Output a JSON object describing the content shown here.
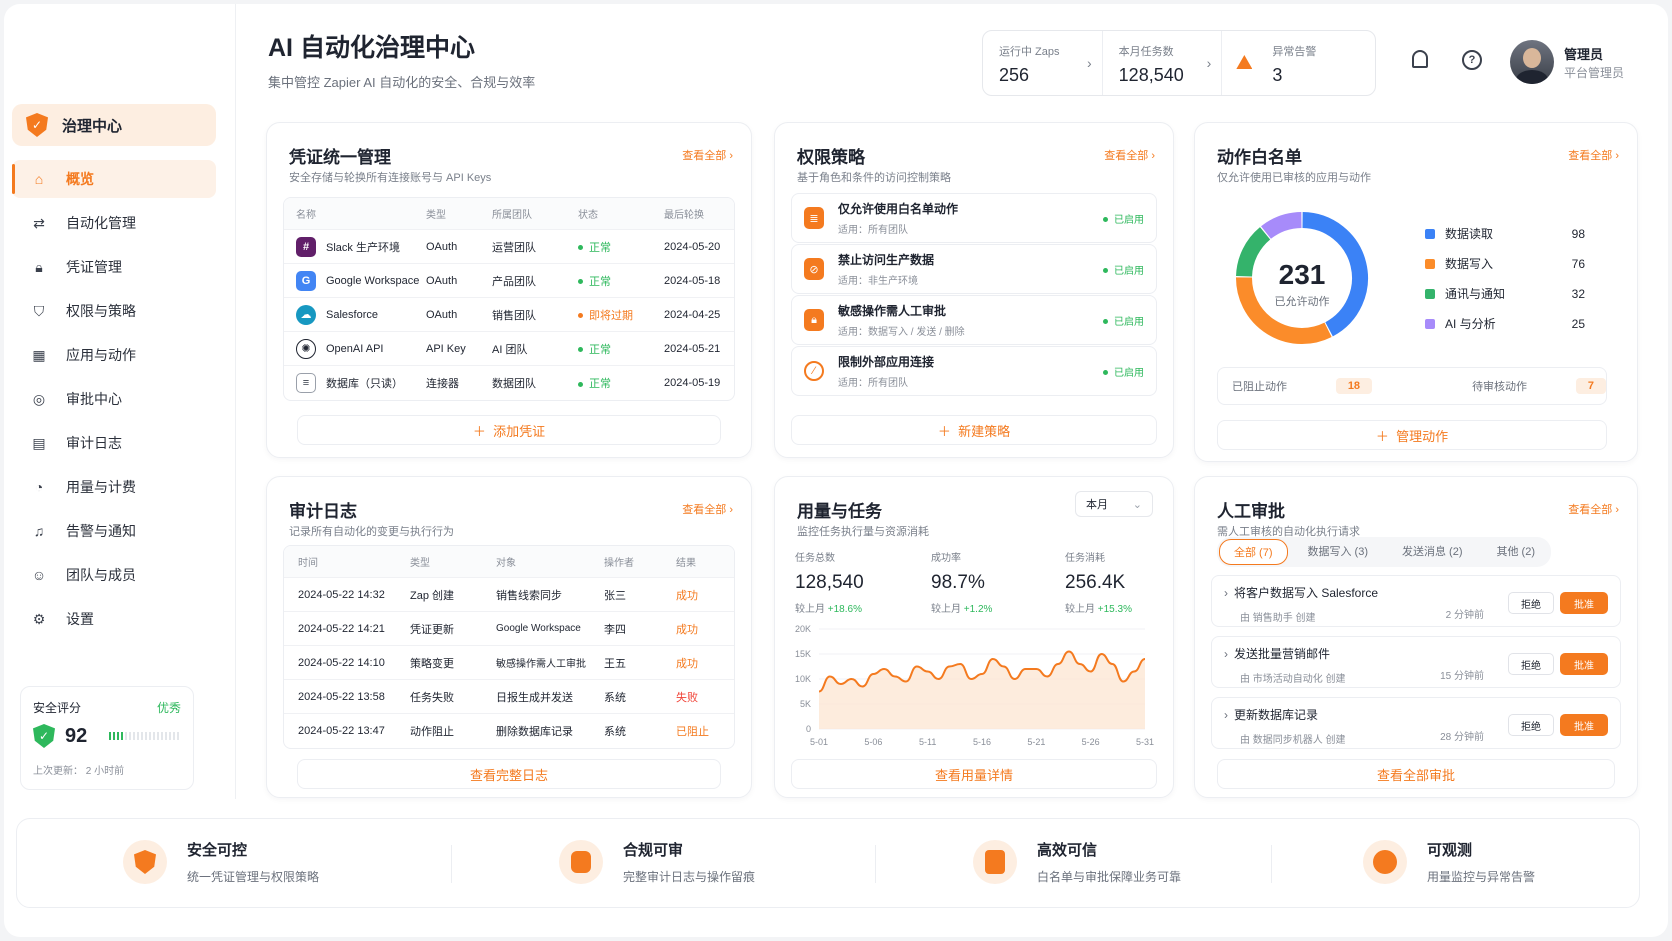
{
  "header": {
    "title": "AI 自动化治理中心",
    "subtitle": "集中管控 Zapier AI 自动化的安全、合规与效率"
  },
  "stats": [
    {
      "label": "运行中 Zaps",
      "value": "256"
    },
    {
      "label": "本月任务数",
      "value": "128,540"
    },
    {
      "label": "异常告警",
      "value": "3"
    }
  ],
  "user": {
    "name": "管理员",
    "role": "平台管理员"
  },
  "sidebar": {
    "brand": "治理中心",
    "items": [
      {
        "label": "概览",
        "icon": "home-icon"
      },
      {
        "label": "自动化管理",
        "icon": "flow-icon"
      },
      {
        "label": "凭证管理",
        "icon": "lock-icon"
      },
      {
        "label": "权限与策略",
        "icon": "shield-icon"
      },
      {
        "label": "应用与动作",
        "icon": "grid-icon"
      },
      {
        "label": "审批中心",
        "icon": "check-circle-icon"
      },
      {
        "label": "审计日志",
        "icon": "document-search-icon"
      },
      {
        "label": "用量与计费",
        "icon": "pie-icon"
      },
      {
        "label": "告警与通知",
        "icon": "bell-icon"
      },
      {
        "label": "团队与成员",
        "icon": "user-icon"
      },
      {
        "label": "设置",
        "icon": "gear-icon"
      }
    ],
    "score": {
      "label": "安全评分",
      "grade": "优秀",
      "value": "92",
      "updated": "上次更新： 2 小时前"
    }
  },
  "credentials": {
    "title": "凭证统一管理",
    "desc": "安全存储与轮换所有连接账号与 API Keys",
    "more": "查看全部",
    "columns": [
      "名称",
      "类型",
      "所属团队",
      "状态",
      "最后轮换"
    ],
    "rows": [
      [
        "Slack 生产环境",
        "OAuth",
        "运营团队",
        "正常",
        "2024-05-20"
      ],
      [
        "Google Workspace",
        "OAuth",
        "产品团队",
        "正常",
        "2024-05-18"
      ],
      [
        "Salesforce",
        "OAuth",
        "销售团队",
        "即将过期",
        "2024-04-25"
      ],
      [
        "OpenAI API",
        "API Key",
        "AI 团队",
        "正常",
        "2024-05-21"
      ],
      [
        "数据库（只读）",
        "连接器",
        "数据团队",
        "正常",
        "2024-05-19"
      ]
    ],
    "add": "添加凭证"
  },
  "policies": {
    "title": "权限策略",
    "desc": "基于角色和条件的访问控制策略",
    "more": "查看全部",
    "items": [
      {
        "title": "仅允许使用白名单动作",
        "scope": "适用：所有团队",
        "status": "已启用"
      },
      {
        "title": "禁止访问生产数据",
        "scope": "适用：非生产环境",
        "status": "已启用"
      },
      {
        "title": "敏感操作需人工审批",
        "scope": "适用：数据写入 / 发送 / 删除",
        "status": "已启用"
      },
      {
        "title": "限制外部应用连接",
        "scope": "适用：所有团队",
        "status": "已启用"
      }
    ],
    "add": "新建策略"
  },
  "whitelist": {
    "title": "动作白名单",
    "desc": "仅允许使用已审核的应用与动作",
    "more": "查看全部",
    "total": "231",
    "total_label": "已允许动作",
    "legend": [
      {
        "label": "数据读取",
        "value": 98,
        "color": "#3b82f6"
      },
      {
        "label": "数据写入",
        "value": 76,
        "color": "#fb8c2a"
      },
      {
        "label": "通讯与通知",
        "value": 32,
        "color": "#34b36b"
      },
      {
        "label": "AI 与分析",
        "value": 25,
        "color": "#a78bfa"
      }
    ],
    "blocked_label": "已阻止动作",
    "blocked": "18",
    "pending_label": "待审核动作",
    "pending": "7",
    "manage": "管理动作"
  },
  "audit": {
    "title": "审计日志",
    "desc": "记录所有自动化的变更与执行行为",
    "more": "查看全部",
    "columns": [
      "时间",
      "类型",
      "对象",
      "操作者",
      "结果"
    ],
    "rows": [
      [
        "2024-05-22 14:32",
        "Zap 创建",
        "销售线索同步",
        "张三",
        "成功"
      ],
      [
        "2024-05-22 14:21",
        "凭证更新",
        "Google Workspace",
        "李四",
        "成功"
      ],
      [
        "2024-05-22 14:10",
        "策略变更",
        "敏感操作需人工审批",
        "王五",
        "成功"
      ],
      [
        "2024-05-22 13:58",
        "任务失败",
        "日报生成并发送",
        "系统",
        "失败"
      ],
      [
        "2024-05-22 13:47",
        "动作阻止",
        "删除数据库记录",
        "系统",
        "已阻止"
      ]
    ],
    "full": "查看完整日志"
  },
  "usage": {
    "title": "用量与任务",
    "desc": "监控任务执行量与资源消耗",
    "period": "本月",
    "metrics": [
      {
        "label": "任务总数",
        "value": "128,540",
        "cmp": "较上月",
        "delta": "+18.6%"
      },
      {
        "label": "成功率",
        "value": "98.7%",
        "cmp": "较上月",
        "delta": "+1.2%"
      },
      {
        "label": "任务消耗",
        "value": "256.4K",
        "cmp": "较上月",
        "delta": "+15.3%"
      }
    ],
    "detail": "查看用量详情"
  },
  "chart_data": {
    "type": "area",
    "x": [
      "5-01",
      "5-02",
      "5-03",
      "5-04",
      "5-05",
      "5-06",
      "5-07",
      "5-08",
      "5-09",
      "5-10",
      "5-11",
      "5-12",
      "5-13",
      "5-14",
      "5-15",
      "5-16",
      "5-17",
      "5-18",
      "5-19",
      "5-20",
      "5-21",
      "5-22",
      "5-23",
      "5-24",
      "5-25",
      "5-26",
      "5-27",
      "5-28",
      "5-29",
      "5-30",
      "5-31"
    ],
    "values": [
      7500,
      10500,
      9000,
      10000,
      8500,
      11000,
      12000,
      10500,
      9500,
      12500,
      11500,
      10000,
      12500,
      13000,
      10000,
      11000,
      14000,
      12500,
      10000,
      12000,
      12000,
      10500,
      13000,
      15500,
      13000,
      11500,
      15000,
      13000,
      9500,
      11500,
      14000
    ],
    "xticks": [
      "5-01",
      "5-06",
      "5-11",
      "5-16",
      "5-21",
      "5-26",
      "5-31"
    ],
    "yticks": [
      "20K",
      "15K",
      "10K",
      "5K",
      "0"
    ],
    "ylim": [
      0,
      20000
    ],
    "color": "#f47a1f"
  },
  "approvals": {
    "title": "人工审批",
    "desc": "需人工审核的自动化执行请求",
    "more": "查看全部",
    "tabs": [
      "全部 (7)",
      "数据写入 (3)",
      "发送消息 (2)",
      "其他 (2)"
    ],
    "items": [
      {
        "title": "将客户数据写入 Salesforce",
        "by": "由 销售助手 创建",
        "time": "2 分钟前"
      },
      {
        "title": "发送批量营销邮件",
        "by": "由 市场活动自动化 创建",
        "time": "15 分钟前"
      },
      {
        "title": "更新数据库记录",
        "by": "由 数据同步机器人 创建",
        "time": "28 分钟前"
      }
    ],
    "reject": "拒绝",
    "approve": "批准",
    "all": "查看全部审批"
  },
  "features": [
    {
      "title": "安全可控",
      "desc": "统一凭证管理与权限策略"
    },
    {
      "title": "合规可审",
      "desc": "完整审计日志与操作留痕"
    },
    {
      "title": "高效可信",
      "desc": "白名单与审批保障业务可靠"
    },
    {
      "title": "可观测",
      "desc": "用量监控与异常告警"
    }
  ]
}
